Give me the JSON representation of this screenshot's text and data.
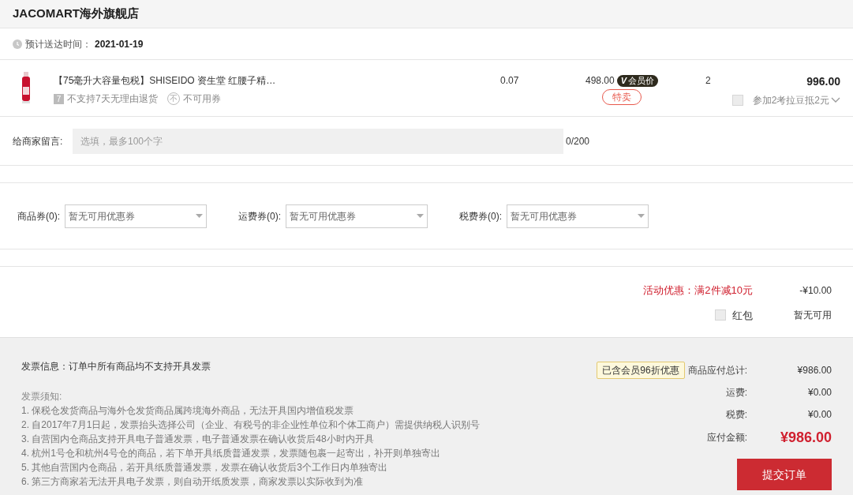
{
  "shop": {
    "name": "JACOMART海外旗舰店"
  },
  "delivery": {
    "label": "预计送达时间：",
    "date": "2021-01-19"
  },
  "item": {
    "title": "【75毫升大容量包税】SHISEIDO 资生堂 红腰子精…",
    "return_badge": "7",
    "return_text": "不支持7天无理由退货",
    "coupon_badge": "不",
    "coupon_text": "不可用券",
    "tax": "0.07",
    "price": "498.00",
    "member_badge_mark": "V",
    "member_badge": "会员价",
    "sale_tag": "特卖",
    "quantity": "2",
    "subtotal": "996.00",
    "koala_beans": {
      "label": "参加2考拉豆抵2元",
      "checked": false
    }
  },
  "message": {
    "label": "给商家留言:",
    "placeholder": "选填，最多100个字",
    "count": "0/200"
  },
  "coupons": [
    {
      "label": "商品券(0):",
      "value": "暂无可用优惠券"
    },
    {
      "label": "运费券(0):",
      "value": "暂无可用优惠券"
    },
    {
      "label": "税费券(0):",
      "value": "暂无可用优惠券"
    }
  ],
  "promotion": {
    "label": "活动优惠：满2件减10元",
    "amount": "-¥10.00"
  },
  "red_packet": {
    "label": "红包",
    "checked": false,
    "status": "暂无可用"
  },
  "invoice": {
    "info": "发票信息：订单中所有商品均不支持开具发票",
    "notice_title": "发票须知:",
    "notices": [
      "1. 保税仓发货商品与海外仓发货商品属跨境海外商品，无法开具国内增值税发票",
      "2. 自2017年7月1日起，发票抬头选择公司（企业、有税号的非企业性单位和个体工商户）需提供纳税人识别号",
      "3. 自营国内仓商品支持开具电子普通发票，电子普通发票在确认收货后48小时内开具",
      "4. 杭州1号仓和杭州4号仓的商品，若下单开具纸质普通发票，发票随包裹一起寄出，补开则单独寄出",
      "5. 其他自营国内仓商品，若开具纸质普通发票，发票在确认收货后3个工作日内单独寄出",
      "6. 第三方商家若无法开具电子发票，则自动开纸质发票，商家发票以实际收到为准"
    ]
  },
  "summary": {
    "member_tip": "已含会员96折优惠",
    "rows": [
      {
        "label": "商品应付总计:",
        "value": "¥986.00",
        "kind": "normal"
      },
      {
        "label": "运费:",
        "value": "¥0.00",
        "kind": "normal"
      },
      {
        "label": "税费:",
        "value": "¥0.00",
        "kind": "normal"
      },
      {
        "label": "应付金额:",
        "value": "¥986.00",
        "kind": "total"
      }
    ],
    "submit": "提交订单"
  }
}
